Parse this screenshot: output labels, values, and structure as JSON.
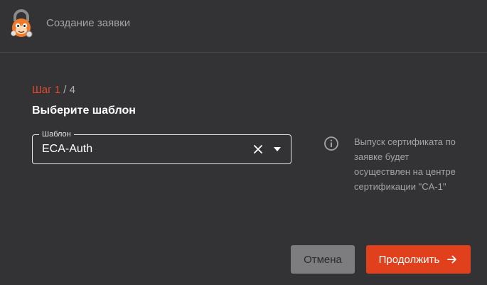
{
  "header": {
    "title": "Создание заявки",
    "logo_icon": "lock-mascot-icon"
  },
  "step": {
    "current": "Шаг 1",
    "separator": " / ",
    "total": "4"
  },
  "section_title": "Выберите шаблон",
  "template_field": {
    "label": "Шаблон",
    "value": "ECA-Auth",
    "clear_icon": "close-icon",
    "dropdown_icon": "caret-down-icon"
  },
  "info": {
    "icon": "info-icon",
    "text": "Выпуск сертификата по заявке будет осуществлен на центре сертификации \"CA-1\""
  },
  "buttons": {
    "cancel_label": "Отмена",
    "continue_label": "Продолжить",
    "continue_icon": "arrow-right-icon"
  },
  "colors": {
    "accent": "#e0401c",
    "background": "#333335",
    "secondary_button": "#7d7d80"
  }
}
